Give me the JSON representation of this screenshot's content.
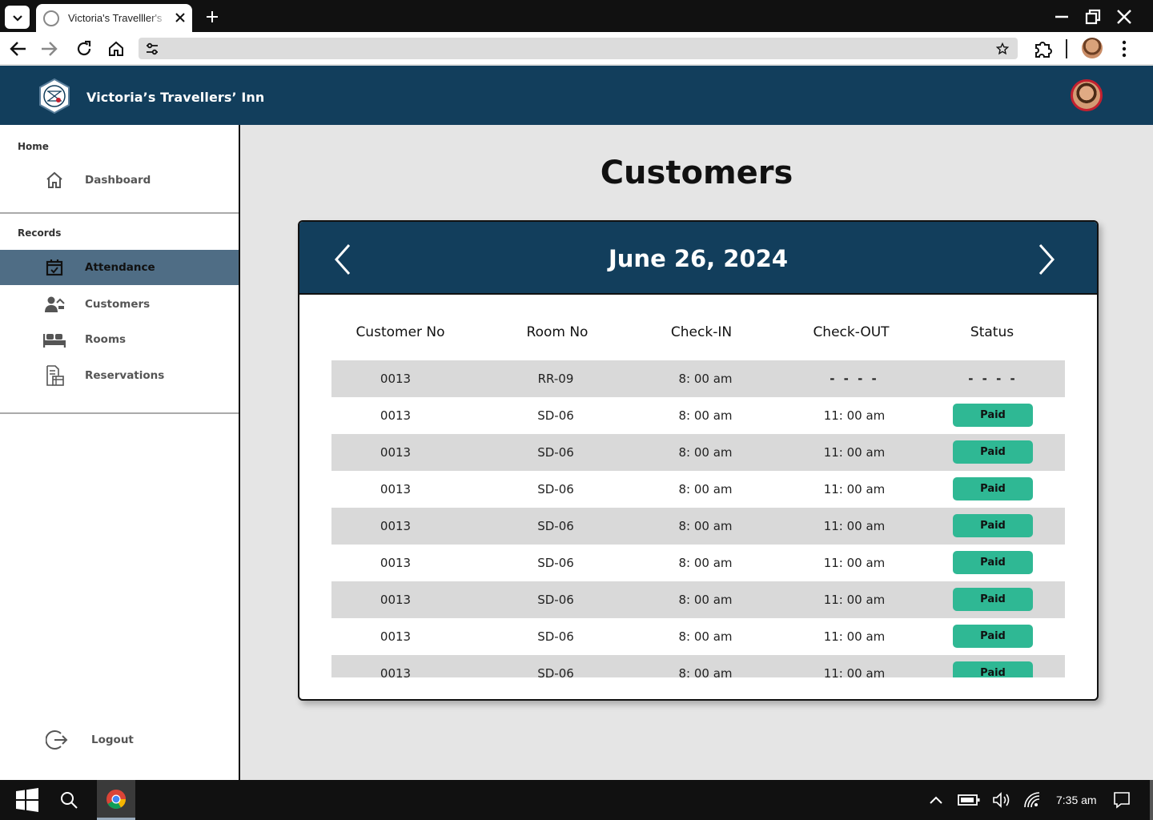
{
  "browser": {
    "tab_title": "Victoria's Travelller's",
    "time": "7:35 am"
  },
  "header": {
    "brand": "Victoria’s Travellers’ Inn"
  },
  "sidebar": {
    "section_home": "Home",
    "section_records": "Records",
    "items": [
      {
        "label": "Dashboard",
        "icon": "home-icon"
      },
      {
        "label": "Attendance",
        "icon": "calendar-check-icon",
        "active": true
      },
      {
        "label": "Customers",
        "icon": "user-group-icon"
      },
      {
        "label": "Rooms",
        "icon": "bed-icon"
      },
      {
        "label": "Reservations",
        "icon": "reservation-icon"
      }
    ],
    "logout": "Logout"
  },
  "main": {
    "title": "Customers",
    "date": "June 26, 2024",
    "columns": [
      "Customer No",
      "Room No",
      "Check-IN",
      "Check-OUT",
      "Status"
    ],
    "rows": [
      {
        "customer": "0013",
        "room": "RR-09",
        "check_in": "8: 00 am",
        "check_out": "- - - -",
        "status": "- - - -"
      },
      {
        "customer": "0013",
        "room": "SD-06",
        "check_in": "8: 00 am",
        "check_out": "11: 00 am",
        "status": "Paid"
      },
      {
        "customer": "0013",
        "room": "SD-06",
        "check_in": "8: 00 am",
        "check_out": "11: 00 am",
        "status": "Paid"
      },
      {
        "customer": "0013",
        "room": "SD-06",
        "check_in": "8: 00 am",
        "check_out": "11: 00 am",
        "status": "Paid"
      },
      {
        "customer": "0013",
        "room": "SD-06",
        "check_in": "8: 00 am",
        "check_out": "11: 00 am",
        "status": "Paid"
      },
      {
        "customer": "0013",
        "room": "SD-06",
        "check_in": "8: 00 am",
        "check_out": "11: 00 am",
        "status": "Paid"
      },
      {
        "customer": "0013",
        "room": "SD-06",
        "check_in": "8: 00 am",
        "check_out": "11: 00 am",
        "status": "Paid"
      },
      {
        "customer": "0013",
        "room": "SD-06",
        "check_in": "8: 00 am",
        "check_out": "11: 00 am",
        "status": "Paid"
      },
      {
        "customer": "0013",
        "room": "SD-06",
        "check_in": "8: 00 am",
        "check_out": "11: 00 am",
        "status": "Paid"
      }
    ]
  },
  "colors": {
    "header_bg": "#123e5c",
    "sidebar_active": "#4f6d85",
    "paid_badge": "#2fb894"
  }
}
